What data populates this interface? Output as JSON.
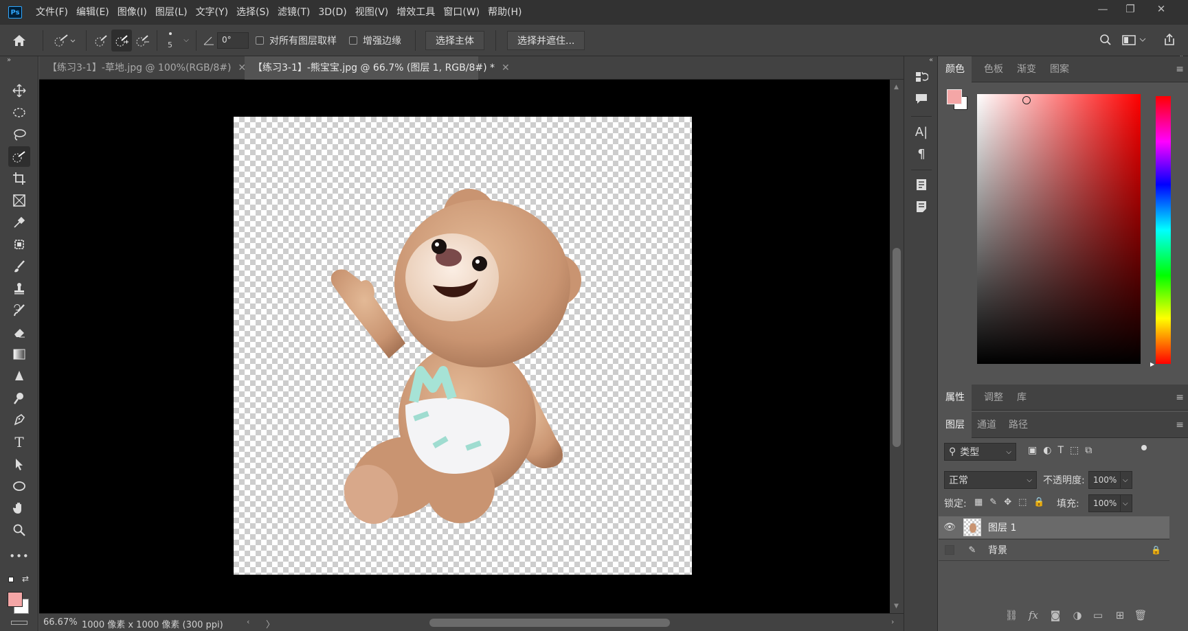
{
  "app": {
    "logo": "Ps"
  },
  "menu": [
    "文件(F)",
    "编辑(E)",
    "图像(I)",
    "图层(L)",
    "文字(Y)",
    "选择(S)",
    "滤镜(T)",
    "3D(D)",
    "视图(V)",
    "增效工具",
    "窗口(W)",
    "帮助(H)"
  ],
  "window_controls": {
    "minimize": "—",
    "restore": "❐",
    "close": "✕"
  },
  "options": {
    "brush_size": "5",
    "angle_value": "0°",
    "sample_all_layers_label": "对所有图层取样",
    "enhance_edge_label": "增强边缘",
    "select_subject_label": "选择主体",
    "select_mask_label": "选择并遮住..."
  },
  "tabs": [
    {
      "label": "【练习3-1】-草地.jpg @ 100%(RGB/8#)",
      "close": "✕"
    },
    {
      "label": "【练习3-1】-熊宝宝.jpg @ 66.7% (图层 1, RGB/8#) *",
      "close": "✕"
    }
  ],
  "status": {
    "zoom": "66.67%",
    "doc_size": "1000 像素 x 1000 像素 (300 ppi)",
    "arrow": "〉"
  },
  "colors": {
    "foreground": "#f4a6a6",
    "background": "#ffffff",
    "canvas_bg": "#000000",
    "accent_hue": "#ff0000"
  },
  "panels": {
    "color_tabs": [
      "颜色",
      "色板",
      "渐变",
      "图案"
    ],
    "props_tabs": [
      "属性",
      "调整",
      "库"
    ],
    "layers_tabs": [
      "图层",
      "通道",
      "路径"
    ],
    "filter_label": "类型",
    "blend_mode": "正常",
    "opacity_label": "不透明度:",
    "opacity_value": "100%",
    "lock_label": "锁定:",
    "fill_label": "填充:",
    "fill_value": "100%",
    "layers": [
      {
        "name": "图层 1",
        "visible": true,
        "selected": true
      },
      {
        "name": "背景",
        "visible": false,
        "locked": true
      }
    ]
  },
  "icons": [
    "home-icon",
    "quick-select-icon",
    "search-icon",
    "workspace-icon",
    "share-icon",
    "move-icon",
    "marquee-icon",
    "lasso-icon",
    "crop-icon",
    "frame-icon",
    "eyedropper-icon",
    "patch-icon",
    "brush-icon",
    "stamp-icon",
    "history-brush-icon",
    "eraser-icon",
    "gradient-icon",
    "blur-icon",
    "dodge-icon",
    "pen-icon",
    "type-icon",
    "path-select-icon",
    "ellipse-icon",
    "hand-icon",
    "zoom-icon",
    "more-icon",
    "eye-icon",
    "lock-icon",
    "link-icon",
    "fx-icon",
    "mask-icon",
    "adjustment-icon",
    "folder-icon",
    "new-layer-icon",
    "trash-icon"
  ]
}
